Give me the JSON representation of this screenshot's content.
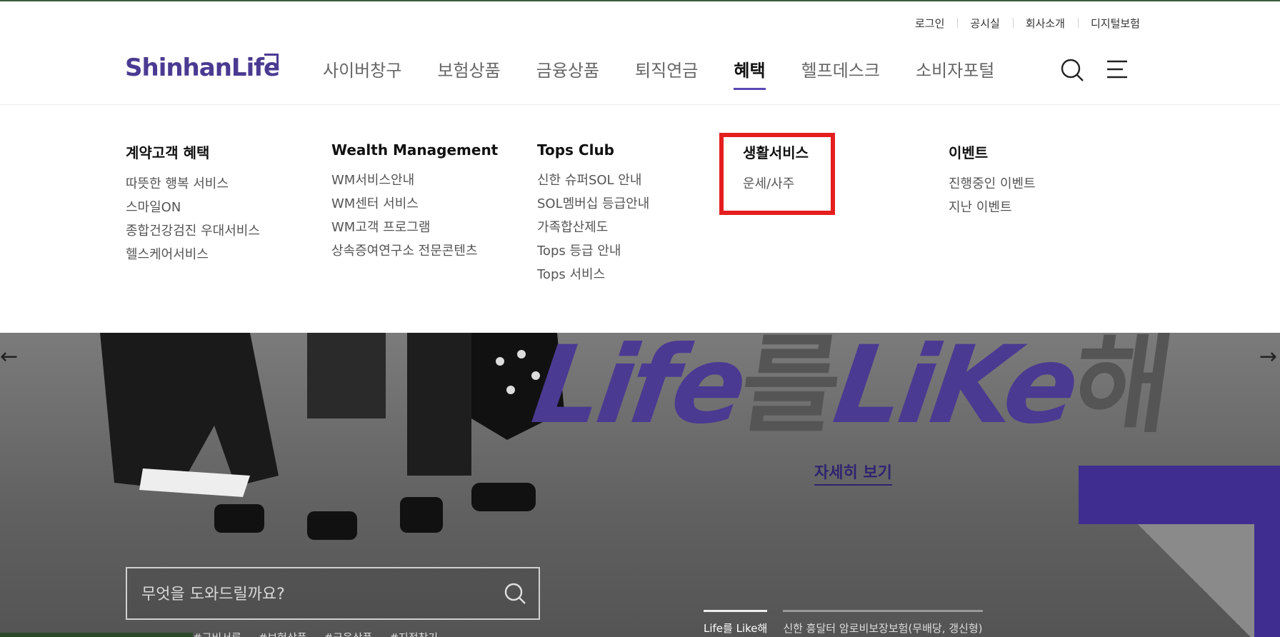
{
  "util": [
    "로그인",
    "공시실",
    "회사소개",
    "디지털보험"
  ],
  "logo": "ShinhanLife",
  "gnb": [
    {
      "label": "사이버창구",
      "active": false
    },
    {
      "label": "보험상품",
      "active": false
    },
    {
      "label": "금융상품",
      "active": false
    },
    {
      "label": "퇴직연금",
      "active": false
    },
    {
      "label": "혜택",
      "active": true
    },
    {
      "label": "헬프데스크",
      "active": false
    },
    {
      "label": "소비자포털",
      "active": false
    }
  ],
  "dropdown": {
    "col1": {
      "title": "계약고객 혜택",
      "items": [
        "따뜻한 행복 서비스",
        "스마일ON",
        "종합건강검진 우대서비스",
        "헬스케어서비스"
      ]
    },
    "col2": {
      "title": "Wealth Management",
      "items": [
        "WM서비스안내",
        "WM센터 서비스",
        "WM고객 프로그램",
        "상속증여연구소 전문콘텐츠"
      ]
    },
    "col3": {
      "title": "Tops Club",
      "items": [
        "신한 슈퍼SOL 안내",
        "SOL멤버십 등급안내",
        "가족합산제도",
        "Tops 등급 안내",
        "Tops 서비스"
      ]
    },
    "col4": {
      "title": "생활서비스",
      "items": [
        "운세/사주"
      ]
    },
    "col5": {
      "title": "이벤트",
      "items": [
        "진행중인 이벤트",
        "지난 이벤트"
      ]
    }
  },
  "hero": {
    "slogan_a": "Life",
    "slogan_b": "를",
    "slogan_c": "LiKe",
    "slogan_d": "해",
    "detail": "자세히 보기",
    "search_placeholder": "무엇을 도와드릴까요?",
    "tags": [
      "#구비서류",
      "#보험상품",
      "#금융상품",
      "#지점찾기"
    ],
    "tabs": [
      "Life를 Like해",
      "신한 흥달터 암로비보장보험(무배당, 갱신형)"
    ]
  },
  "colors": {
    "brand": "#4b3a92",
    "highlight": "#e41e1e"
  }
}
